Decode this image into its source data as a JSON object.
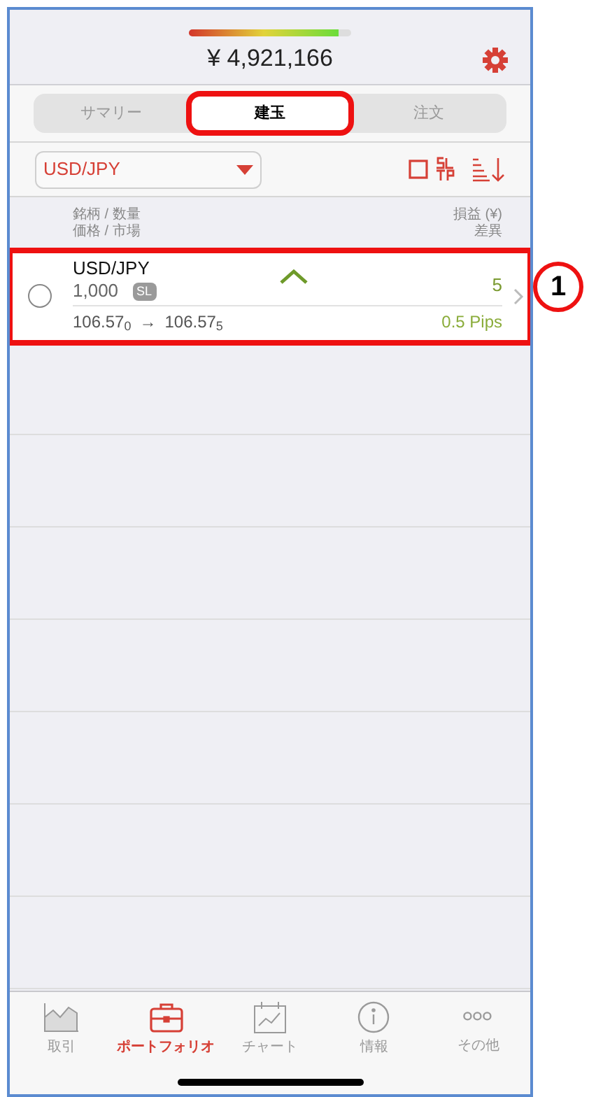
{
  "header": {
    "margin_meter": {
      "level": 0.92
    },
    "balance": "¥ 4,921,166"
  },
  "segments": [
    {
      "label": "サマリー",
      "selected": false,
      "highlighted": false
    },
    {
      "label": "建玉",
      "selected": true,
      "highlighted": true
    },
    {
      "label": "注文",
      "selected": false,
      "highlighted": false
    }
  ],
  "filter": {
    "value": "USD/JPY",
    "select_all": {
      "checked": false
    }
  },
  "columns": {
    "left": [
      "銘柄 / 数量",
      "価格 / 市場"
    ],
    "right": [
      "損益 (¥)",
      "差異"
    ]
  },
  "positions": [
    {
      "symbol": "USD/JPY",
      "quantity": "1,000",
      "tag": "SL",
      "pl": "5",
      "open_price": "106.57$_{0}$",
      "arrow": "→",
      "market_price": "106.57$_{5}$",
      "diff": "0.5 Pips",
      "checked": false,
      "highlighted": true,
      "callout": "1"
    }
  ],
  "tabbar": [
    {
      "label": "取引",
      "kind": "trade",
      "selected": false
    },
    {
      "label": "ポートフォリオ",
      "kind": "portfolio",
      "selected": true
    },
    {
      "label": "チャート",
      "kind": "chart",
      "selected": false
    },
    {
      "label": "情報",
      "kind": "info",
      "selected": false
    },
    {
      "label": "その他",
      "kind": "more",
      "selected": false
    }
  ]
}
